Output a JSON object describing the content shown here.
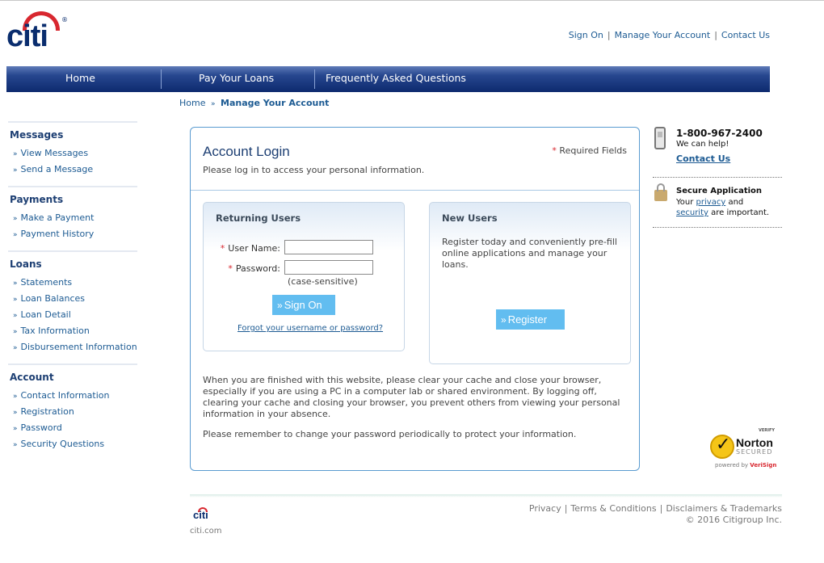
{
  "brand": {
    "logo_text": "citi",
    "registered": "®"
  },
  "top_links": [
    "Sign On",
    "Manage Your Account",
    "Contact Us"
  ],
  "nav": [
    "Home",
    "Pay Your Loans",
    "Frequently Asked Questions"
  ],
  "breadcrumb": {
    "home": "Home",
    "separator": "»",
    "current": "Manage Your Account"
  },
  "sidebar": [
    {
      "heading": "Messages",
      "items": [
        "View Messages",
        "Send a Message"
      ]
    },
    {
      "heading": "Payments",
      "items": [
        "Make a Payment",
        "Payment History"
      ]
    },
    {
      "heading": "Loans",
      "items": [
        "Statements",
        "Loan Balances",
        "Loan Detail",
        "Tax Information",
        "Disbursement Information"
      ]
    },
    {
      "heading": "Account",
      "items": [
        "Contact Information",
        "Registration",
        "Password",
        "Security Questions"
      ]
    }
  ],
  "login": {
    "title": "Account Login",
    "subtitle": "Please log in to access your personal information.",
    "required_star": "*",
    "required_label": "Required Fields",
    "returning": {
      "title": "Returning Users",
      "username_label": "User Name:",
      "username_value": "",
      "password_label": "Password:",
      "password_value": "",
      "case_note": "(case-sensitive)",
      "signon_button": "Sign On",
      "forgot_link": "Forgot your username or password?"
    },
    "new_users": {
      "title": "New Users",
      "text": "Register today and conveniently pre-fill online applications and manage your loans.",
      "register_button": "Register"
    },
    "para1": "When you are finished with this website, please clear your cache and close your browser, especially if you are using a PC in a computer lab or shared environment. By logging off, clearing your cache and closing your browser, you prevent others from viewing your personal information in your absence.",
    "para2": "Please remember to change your password periodically to protect your information."
  },
  "help": {
    "phone": "1-800-967-2400",
    "help_text": "We can help!",
    "contact_link": "Contact Us",
    "secure_title": "Secure Application",
    "secure_pre": "Your",
    "privacy_link": "privacy",
    "secure_and": "and",
    "security_link": "security",
    "secure_post": "are important."
  },
  "norton": {
    "verify": "VERIFY",
    "name": "Norton",
    "secured": "SECURED",
    "powered_pre": "powered by",
    "powered_brand": "VeriSign"
  },
  "footer": {
    "logo": "citi",
    "site": "citi.com",
    "links": [
      "Privacy",
      "Terms & Conditions",
      "Disclaimers & Trademarks"
    ],
    "copyright": "© 2016 Citigroup Inc."
  }
}
